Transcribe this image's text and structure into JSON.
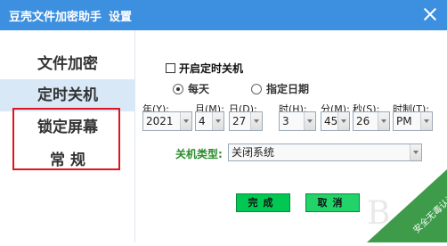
{
  "window": {
    "title": "豆壳文件加密助手",
    "settings": "设置"
  },
  "sidebar": {
    "items": [
      {
        "label": "文件加密"
      },
      {
        "label": "定时关机"
      },
      {
        "label": "锁定屏幕"
      },
      {
        "label": "常 规"
      }
    ]
  },
  "content": {
    "enable_shutdown": "开启定时关机",
    "mode": {
      "daily": "每天",
      "date": "指定日期"
    },
    "fields": [
      {
        "label": "年(Y):",
        "value": "2021"
      },
      {
        "label": "月(M):",
        "value": "4"
      },
      {
        "label": "日(D):",
        "value": "27"
      },
      {
        "label": "时(H):",
        "value": "3"
      },
      {
        "label": "分(M):",
        "value": "45"
      },
      {
        "label": "秒(S):",
        "value": "26"
      },
      {
        "label": "时制(T):",
        "value": "PM"
      }
    ],
    "shutdown_type_label": "关机类型:",
    "shutdown_type_value": "关闭系统"
  },
  "buttons": {
    "ok": "完成",
    "cancel": "取消"
  },
  "watermark": {
    "text": "安全无毒认证"
  },
  "colors": {
    "titlebar": "#3d8fdf",
    "active_sidebar": "#d9e8f7",
    "highlight_border": "#e0151f",
    "button_green": "#00c853",
    "label_green": "#2d8c2f"
  }
}
